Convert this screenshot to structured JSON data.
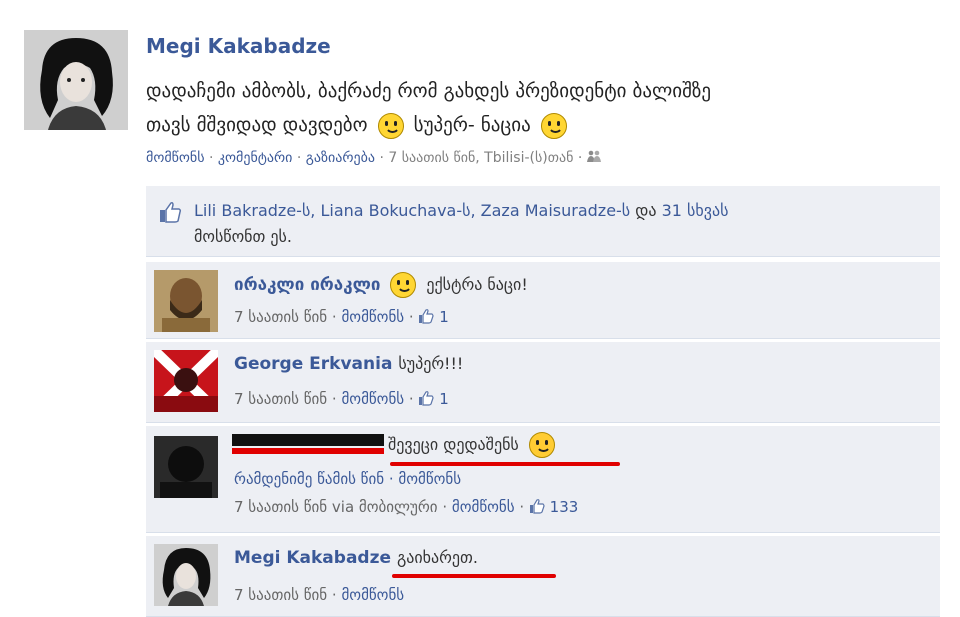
{
  "post": {
    "author": "Megi Kakabadze",
    "text_line1": "დადაჩემი ამბობს, ბაქრაძე რომ გახდეს პრეზიდენტი ბალიშზე",
    "text_line2a": "თავს მშვიდად დავდებო",
    "text_line2b": "სუპერ- ნაცია",
    "meta": {
      "like": "მომწონს",
      "comment": "კომენტარი",
      "share": "გაზიარება",
      "time": "7 საათის წინ, Tbilisi-(ს)თან",
      "sep": "·"
    }
  },
  "likes": {
    "names": "Lili Bakradze-ს, Liana Bokuchava-ს, Zaza Maisuradze-ს",
    "and": "და",
    "others": "31 სხვას",
    "tail": "მოსწონთ ეს."
  },
  "comments": [
    {
      "name": "ირაკლი ირაკლი",
      "text": "ექსტრა ნაცი!",
      "time": "7 საათის წინ",
      "like": "მომწონს",
      "likes_count": "1"
    },
    {
      "name": "George Erkvania",
      "text": "სუპერ!!!",
      "time": "7 საათის წინ",
      "like": "მომწონს",
      "likes_count": "1"
    },
    {
      "name": "",
      "text": "შევეცი დედაშენს",
      "sub": "რამდენიმე წამის წინ · მომწონს",
      "time": "7 საათის წინ via მობილური",
      "like": "მომწონს",
      "likes_count": "133"
    },
    {
      "name": "Megi Kakabadze",
      "text": "გაიხარეთ.",
      "time": "7 საათის წინ",
      "like": "მომწონს"
    }
  ],
  "colors": {
    "link": "#3b5998",
    "box_bg": "#edeff4",
    "underline": "#e00000"
  }
}
